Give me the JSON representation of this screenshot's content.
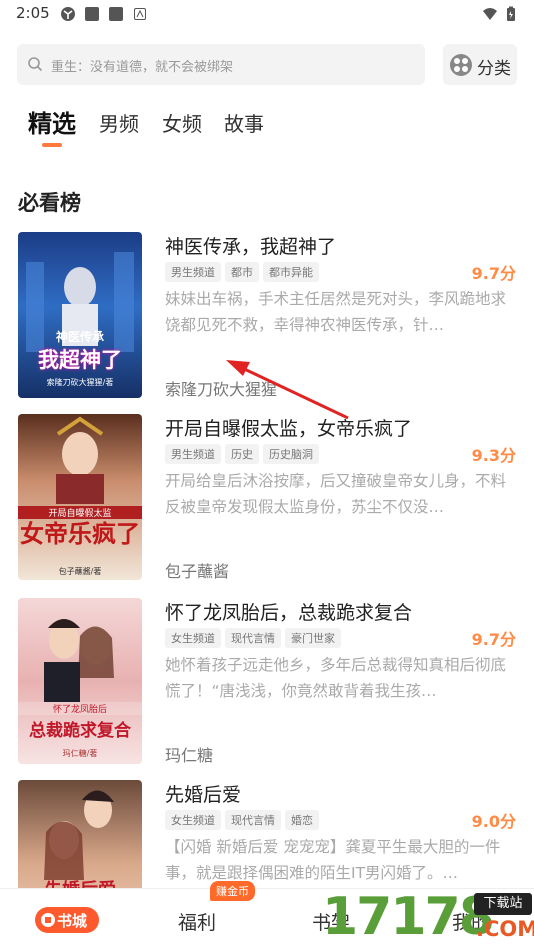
{
  "status": {
    "time": "2:05"
  },
  "search": {
    "placeholder": "重生：没有道德，就不会被绑架"
  },
  "category": {
    "label": "分类"
  },
  "tabs": [
    {
      "label": "精选",
      "active": true
    },
    {
      "label": "男频"
    },
    {
      "label": "女频"
    },
    {
      "label": "故事"
    }
  ],
  "section": {
    "title": "必看榜"
  },
  "books": [
    {
      "title": "神医传承，我超神了",
      "tags": [
        "男生频道",
        "都市",
        "都市异能"
      ],
      "score": "9.7分",
      "desc": "妹妹出车祸，手术主任居然是死对头，李风跪地求饶都见死不救，幸得神农神医传承，针…",
      "author": "索隆刀砍大猩猩",
      "cover_text": [
        "神医传承",
        "我超神了"
      ],
      "cover_byline": "索隆刀砍大猩猩/著"
    },
    {
      "title": "开局自曝假太监，女帝乐疯了",
      "tags": [
        "男生频道",
        "历史",
        "历史脑洞"
      ],
      "score": "9.3分",
      "desc": "开局给皇后沐浴按摩，后又撞破皇帝女儿身，不料反被皇帝发现假太监身份，苏尘不仅没…",
      "author": "包子蘸酱",
      "cover_text": [
        "开局自曝假太监",
        "女帝乐疯了"
      ],
      "cover_byline": "包子蘸酱/著"
    },
    {
      "title": "怀了龙凤胎后，总裁跪求复合",
      "tags": [
        "女生频道",
        "现代言情",
        "豪门世家"
      ],
      "score": "9.7分",
      "desc": "她怀着孩子远走他乡，多年后总裁得知真相后彻底慌了！“唐浅浅，你竟然敢背着我生孩…",
      "author": "玛仁糖",
      "cover_text": [
        "怀了龙凤胎后",
        "总裁跪求复合"
      ],
      "cover_byline": "玛仁糖/著"
    },
    {
      "title": "先婚后爱",
      "tags": [
        "女生频道",
        "现代言情",
        "婚恋"
      ],
      "score": "9.0分",
      "desc": "【闪婚 新婚后爱 宠宠宠】龚夏平生最大胆的一件事，就是跟择偶困难的陌生IT男闪婚了。…",
      "author": "",
      "cover_text": [
        "先婚后爱"
      ],
      "cover_byline": ""
    }
  ],
  "nav": {
    "bookstore": "书城",
    "welfare": "福利",
    "welfare_badge": "赚金币",
    "shelf": "书架",
    "mine": "我的"
  },
  "watermark": {
    "digits": "17178",
    "box": "下载站",
    "com": ".COM"
  },
  "colors": {
    "accent": "#ff7a3d",
    "score": "#ff8b47",
    "bookstore": "#ff5a2d",
    "arrow": "#e02424"
  }
}
